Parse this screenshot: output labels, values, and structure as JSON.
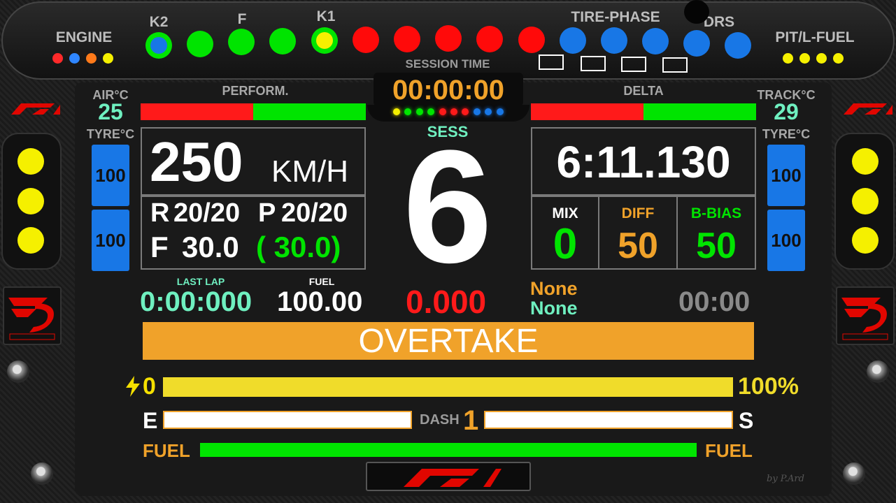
{
  "colors": {
    "accent_orange": "#f0a22a",
    "green": "#00e400",
    "red": "#ff1a1a",
    "blue": "#1877e6",
    "yellow": "#f5f000",
    "cyan_text": "#6ff0c0",
    "grey_text": "#8a8a8a"
  },
  "top": {
    "engine_label": "ENGINE",
    "engine_dots": [
      "#ff2a2a",
      "#2f86ff",
      "#ff7a1a",
      "#f5f000"
    ],
    "k2_label": "K2",
    "f_label": "F",
    "k1_label": "K1",
    "tire_phase_label": "TIRE-PHASE",
    "drs_label": "DRS",
    "pit_fuel_label": "PIT/L-FUEL",
    "pit_dots": [
      "#f5f000",
      "#f5f000",
      "#f5f000",
      "#f5f000"
    ],
    "session_time_label": "SESSION TIME",
    "session_time": "00:00:00",
    "rev_leds": [
      "k2-blue",
      "green",
      "green",
      "green",
      "k1-yellow",
      "red",
      "red",
      "red",
      "red",
      "red",
      "blue",
      "blue",
      "blue",
      "blue",
      "blue"
    ]
  },
  "left": {
    "air_label": "AIR°C",
    "air_value": "25",
    "tyre_label": "TYRE°C",
    "tyre_front": "100",
    "tyre_rear": "100"
  },
  "right": {
    "track_label": "TRACK°C",
    "track_value": "29",
    "tyre_label": "TYRE°C",
    "tyre_front": "100",
    "tyre_rear": "100"
  },
  "perform": {
    "label": "PERFORM.",
    "red_fraction": 0.5
  },
  "delta": {
    "label": "DELTA",
    "red_fraction": 0.5
  },
  "speed": {
    "value": "250",
    "unit": "KM/H"
  },
  "rp": {
    "r_label": "R",
    "r_value": "20/20",
    "p_label": "P",
    "p_value": "20/20",
    "f_label": "F",
    "f_value": "30.0",
    "f_target": "( 30.0)"
  },
  "gear": {
    "sess_label": "SESS",
    "value": "6"
  },
  "laptime": "6:11.130",
  "settings": {
    "mix_label": "MIX",
    "mix_value": "0",
    "diff_label": "DIFF",
    "diff_value": "50",
    "bbias_label": "B-BIAS",
    "bbias_value": "50"
  },
  "info": {
    "last_lap_label": "LAST LAP",
    "last_lap": "0:00:000",
    "fuel_label": "FUEL",
    "fuel": "100.00",
    "delta_value": "0.000",
    "none1": "None",
    "none2": "None",
    "timer": "00:00"
  },
  "overtake": "OVERTAKE",
  "energy": {
    "left": "0",
    "right": "100%",
    "fraction": 1.0
  },
  "dash": {
    "e_label": "E",
    "s_label": "S",
    "dash_label": "DASH",
    "dash_value": "1"
  },
  "fuel_bar": {
    "left": "FUEL",
    "right": "FUEL",
    "fraction": 1.0
  },
  "signature": "by P.Ard"
}
